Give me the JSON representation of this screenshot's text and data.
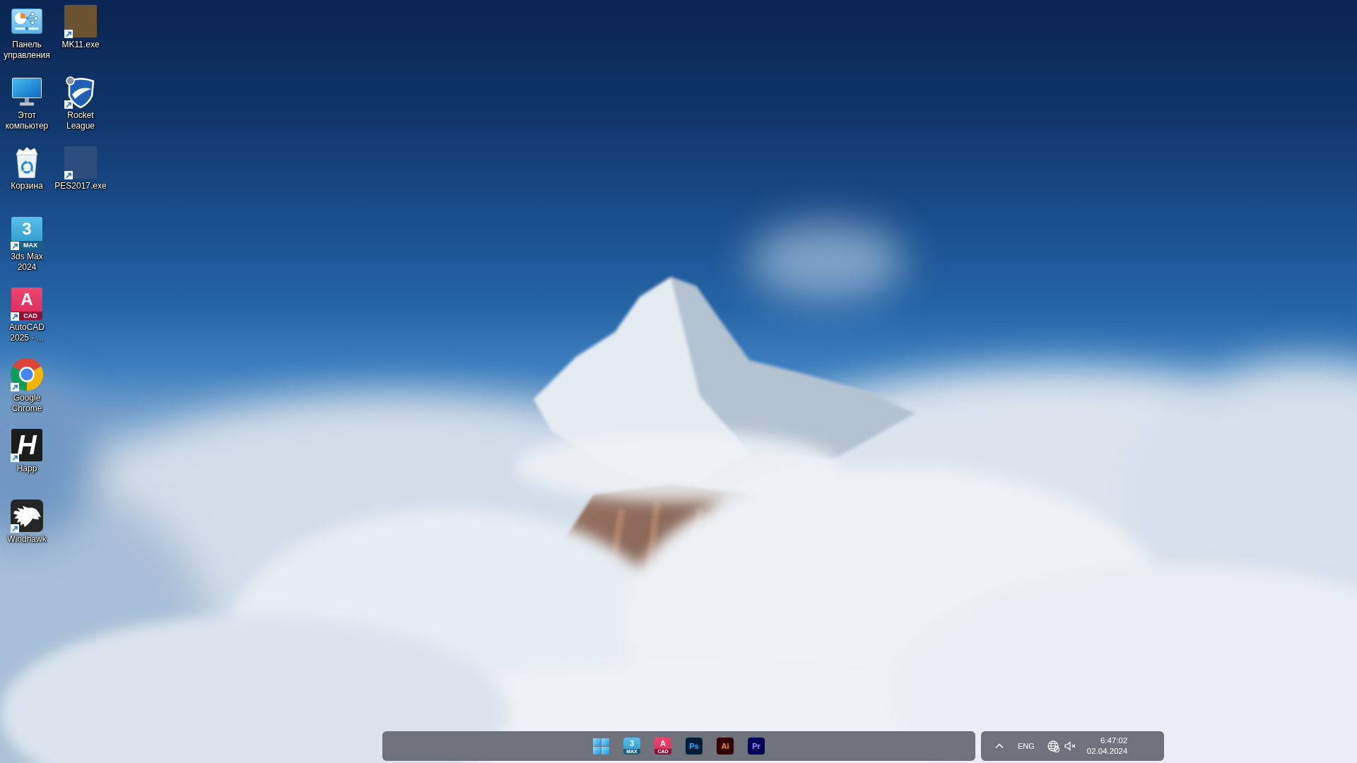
{
  "desktop_icon_columns": [
    {
      "icons": [
        {
          "kind": "panel",
          "label": "Панель управления",
          "shortcut": false
        },
        {
          "kind": "monitor",
          "label": "Этот компьютер",
          "shortcut": false
        },
        {
          "kind": "bin",
          "label": "Корзина",
          "shortcut": false
        },
        {
          "kind": "max",
          "label": "3ds Max 2024",
          "shortcut": true,
          "glyph": "3",
          "badge": "MAX"
        },
        {
          "kind": "cad",
          "label": "AutoCAD 2025 - ...",
          "shortcut": true,
          "glyph": "A",
          "badge": "CAD"
        },
        {
          "kind": "chrome",
          "label": "Google Chrome",
          "shortcut": true
        },
        {
          "kind": "happ",
          "label": "Happ",
          "shortcut": true,
          "glyph": "H"
        },
        {
          "kind": "eagle",
          "label": "Windhawk",
          "shortcut": true
        }
      ]
    },
    {
      "icons": [
        {
          "kind": "cover",
          "label": "MK11.exe",
          "shortcut": true,
          "color": "#6b5230"
        },
        {
          "kind": "shield",
          "label": "Rocket League",
          "shortcut": true
        },
        {
          "kind": "cover",
          "label": "PES2017.exe",
          "shortcut": true,
          "color": "#2d4d7c"
        }
      ]
    }
  ],
  "taskbar": {
    "apps": [
      {
        "kind": "start"
      },
      {
        "kind": "max",
        "glyph": "3",
        "badge": "MAX"
      },
      {
        "kind": "cad",
        "glyph": "A",
        "badge": "CAD"
      },
      {
        "kind": "ps",
        "glyph": "Ps"
      },
      {
        "kind": "ai",
        "glyph": "Ai"
      },
      {
        "kind": "pr",
        "glyph": "Pr"
      }
    ]
  },
  "tray": {
    "language": "ENG",
    "time": "6:47:02",
    "date": "02.04.2024"
  }
}
